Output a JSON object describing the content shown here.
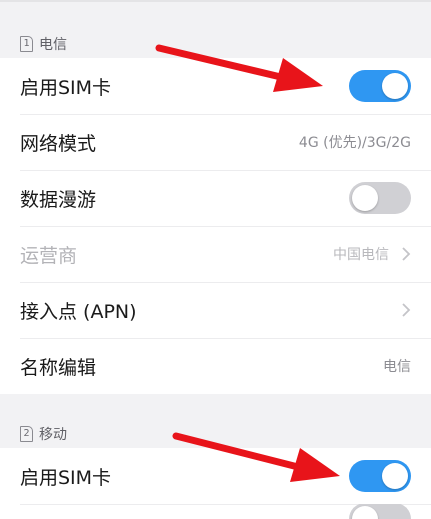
{
  "sim1": {
    "badge": "1",
    "carrier": "电信",
    "rows": [
      {
        "label": "启用SIM卡",
        "toggle": true
      },
      {
        "label": "网络模式",
        "value": "4G (优先)/3G/2G"
      },
      {
        "label": "数据漫游",
        "toggle": false
      },
      {
        "label": "运营商",
        "value": "中国电信",
        "disabled": true,
        "chevron": true
      },
      {
        "label": "接入点 (APN)",
        "chevron": true
      },
      {
        "label": "名称编辑",
        "value": "电信"
      }
    ]
  },
  "sim2": {
    "badge": "2",
    "carrier": "移动",
    "rows": [
      {
        "label": "启用SIM卡",
        "toggle": true
      }
    ]
  },
  "colors": {
    "toggle_on": "#2f97f2",
    "toggle_off": "#d0d0d4",
    "annotation_arrow": "#e8141a"
  },
  "icons": {
    "chevron": "chevron-right-icon",
    "annotation": "red-arrow-annotation"
  }
}
